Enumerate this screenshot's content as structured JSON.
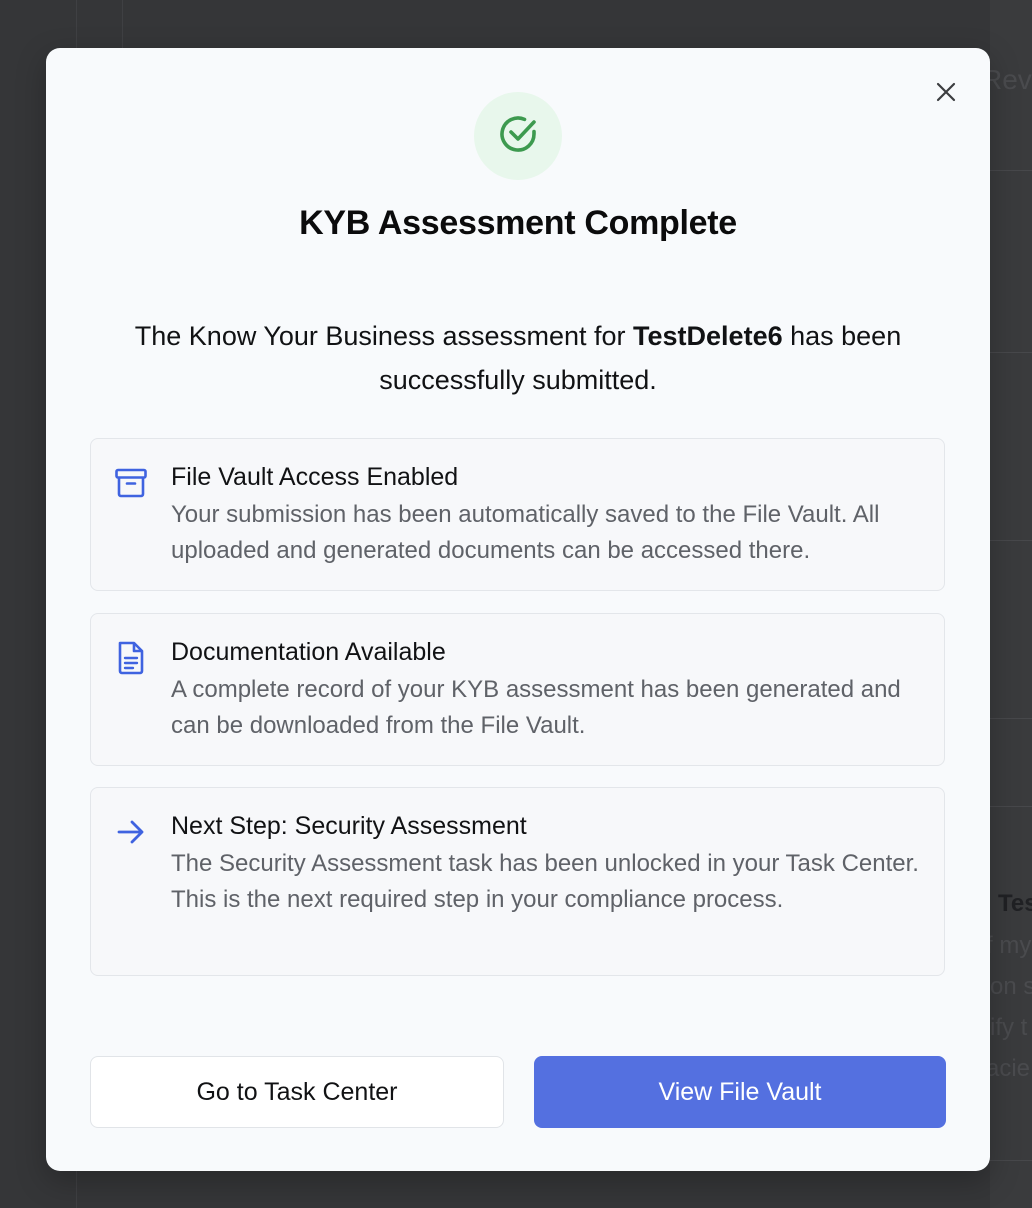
{
  "background": {
    "fragments": [
      "Reve",
      "Tes",
      "f my",
      "on s",
      "ify t",
      "acie"
    ]
  },
  "modal": {
    "close_icon": "close-icon",
    "success_icon": "check-circle-icon",
    "title": "KYB Assessment Complete",
    "description_before": "The Know Your Business assessment for ",
    "company_name": "TestDelete6",
    "description_after": " has been successfully submitted.",
    "cards": [
      {
        "icon": "archive-box-icon",
        "title": "File Vault Access Enabled",
        "body": "Your submission has been automatically saved to the File Vault. All uploaded and generated documents can be accessed there."
      },
      {
        "icon": "document-icon",
        "title": "Documentation Available",
        "body": "A complete record of your KYB assessment has been generated and can be downloaded from the File Vault."
      },
      {
        "icon": "arrow-right-icon",
        "title": "Next Step: Security Assessment",
        "body": "The Security Assessment task has been unlocked in your Task Center. This is the next required step in your compliance process."
      }
    ],
    "secondary_button": "Go to Task Center",
    "primary_button": "View File Vault"
  },
  "colors": {
    "primary": "#5470e0",
    "success": "#3d9a4f",
    "success_bg": "#e8f7ec",
    "icon_accent": "#3f63e0"
  }
}
